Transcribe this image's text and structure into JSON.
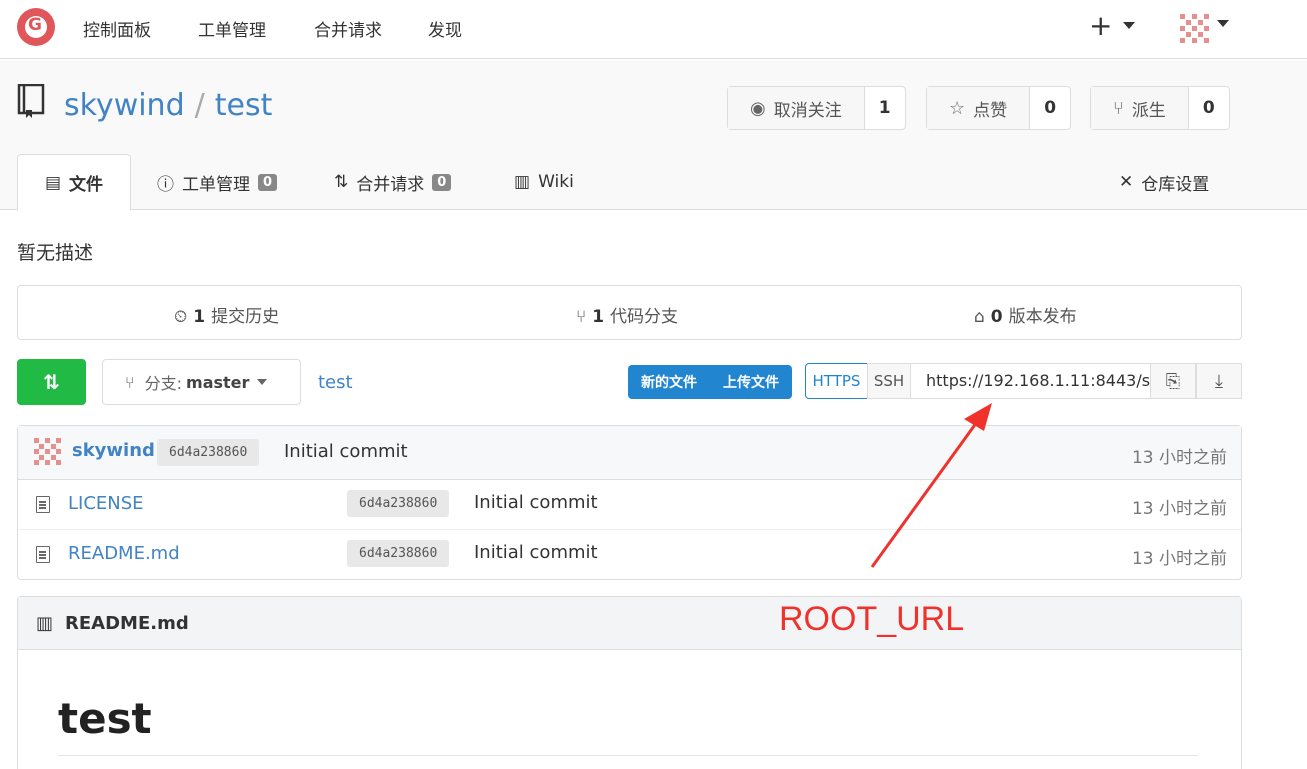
{
  "topnav": {
    "items": [
      "控制面板",
      "工单管理",
      "合并请求",
      "发现"
    ],
    "plus": "+"
  },
  "repo": {
    "owner": "skywind",
    "separator": "/",
    "name": "test",
    "watch": {
      "label": "取消关注",
      "count": "1"
    },
    "star": {
      "label": "点赞",
      "count": "0"
    },
    "fork": {
      "label": "派生",
      "count": "0"
    }
  },
  "tabs": {
    "files": "文件",
    "issues": "工单管理",
    "issues_count": "0",
    "pulls": "合并请求",
    "pulls_count": "0",
    "wiki": "Wiki",
    "settings": "仓库设置"
  },
  "description": "暂无描述",
  "stats": {
    "commits_num": "1",
    "commits_label": "提交历史",
    "branches_num": "1",
    "branches_label": "代码分支",
    "releases_num": "0",
    "releases_label": "版本发布"
  },
  "toolbar": {
    "branch_prefix": "分支:",
    "branch_name": "master",
    "breadcrumb": "test",
    "new_file": "新的文件",
    "upload_file": "上传文件",
    "https": "HTTPS",
    "ssh": "SSH",
    "clone_url": "https://192.168.1.11:8443/s"
  },
  "latest_commit": {
    "author": "skywind",
    "sha": "6d4a238860",
    "message": "Initial commit",
    "age": "13 小时之前"
  },
  "files": [
    {
      "name": "LICENSE",
      "sha": "6d4a238860",
      "message": "Initial commit",
      "age": "13 小时之前"
    },
    {
      "name": "README.md",
      "sha": "6d4a238860",
      "message": "Initial commit",
      "age": "13 小时之前"
    }
  ],
  "readme": {
    "filename": "README.md",
    "heading": "test"
  },
  "annotation": {
    "text": "ROOT_URL",
    "color": "#f0322d"
  },
  "colors": {
    "link": "#4183c4",
    "primary": "#2185d0",
    "success": "#21ba45",
    "logo": "#e0575b"
  }
}
